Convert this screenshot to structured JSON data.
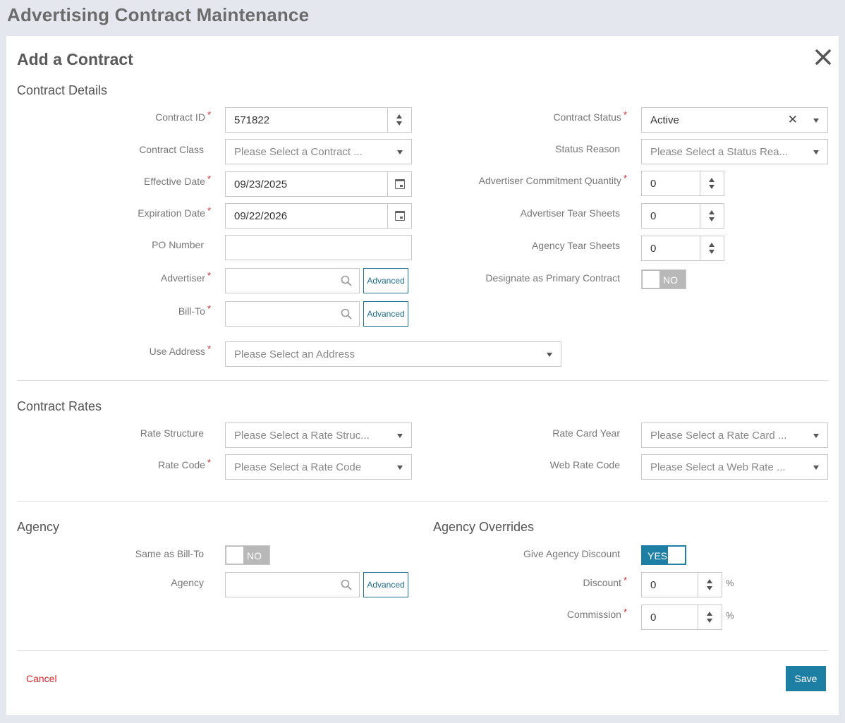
{
  "page": {
    "title": "Advertising Contract Maintenance"
  },
  "modal": {
    "title": "Add a Contract",
    "close_icon": "close-icon",
    "required_mark": "*"
  },
  "contract_details": {
    "section_title": "Contract Details",
    "contract_id": {
      "label": "Contract ID",
      "value": "571822"
    },
    "contract_class": {
      "label": "Contract Class",
      "placeholder": "Please Select a Contract ..."
    },
    "effective_date": {
      "label": "Effective Date",
      "value": "09/23/2025"
    },
    "expiration_date": {
      "label": "Expiration Date",
      "value": "09/22/2026"
    },
    "po_number": {
      "label": "PO Number",
      "value": ""
    },
    "advertiser": {
      "label": "Advertiser",
      "value": "",
      "advanced_label": "Advanced"
    },
    "bill_to": {
      "label": "Bill-To",
      "value": "",
      "advanced_label": "Advanced"
    },
    "use_address": {
      "label": "Use Address",
      "placeholder": "Please Select an Address"
    },
    "contract_status": {
      "label": "Contract Status",
      "value": "Active"
    },
    "status_reason": {
      "label": "Status Reason",
      "placeholder": "Please Select a Status Rea..."
    },
    "advertiser_commitment_quantity": {
      "label": "Advertiser Commitment Quantity",
      "value": "0"
    },
    "advertiser_tear_sheets": {
      "label": "Advertiser Tear Sheets",
      "value": "0"
    },
    "agency_tear_sheets": {
      "label": "Agency Tear Sheets",
      "value": "0"
    },
    "designate_primary": {
      "label": "Designate as Primary Contract",
      "toggle": "NO"
    }
  },
  "contract_rates": {
    "section_title": "Contract Rates",
    "rate_structure": {
      "label": "Rate Structure",
      "placeholder": "Please Select a Rate Struc..."
    },
    "rate_code": {
      "label": "Rate Code",
      "placeholder": "Please Select a Rate Code"
    },
    "rate_card_year": {
      "label": "Rate Card Year",
      "placeholder": "Please Select a Rate Card ..."
    },
    "web_rate_code": {
      "label": "Web Rate Code",
      "placeholder": "Please Select a Web Rate ..."
    }
  },
  "agency": {
    "section_title": "Agency",
    "same_as_bill_to": {
      "label": "Same as Bill-To",
      "toggle": "NO"
    },
    "agency_field": {
      "label": "Agency",
      "value": "",
      "advanced_label": "Advanced"
    }
  },
  "agency_overrides": {
    "section_title": "Agency Overrides",
    "give_agency_discount": {
      "label": "Give Agency Discount",
      "toggle": "YES"
    },
    "discount": {
      "label": "Discount",
      "value": "0",
      "unit": "%"
    },
    "commission": {
      "label": "Commission",
      "value": "0",
      "unit": "%"
    }
  },
  "footer": {
    "cancel_label": "Cancel",
    "save_label": "Save"
  },
  "colors": {
    "accent": "#1d7fa3",
    "required": "#d9262f",
    "cancel": "#d9262f"
  }
}
